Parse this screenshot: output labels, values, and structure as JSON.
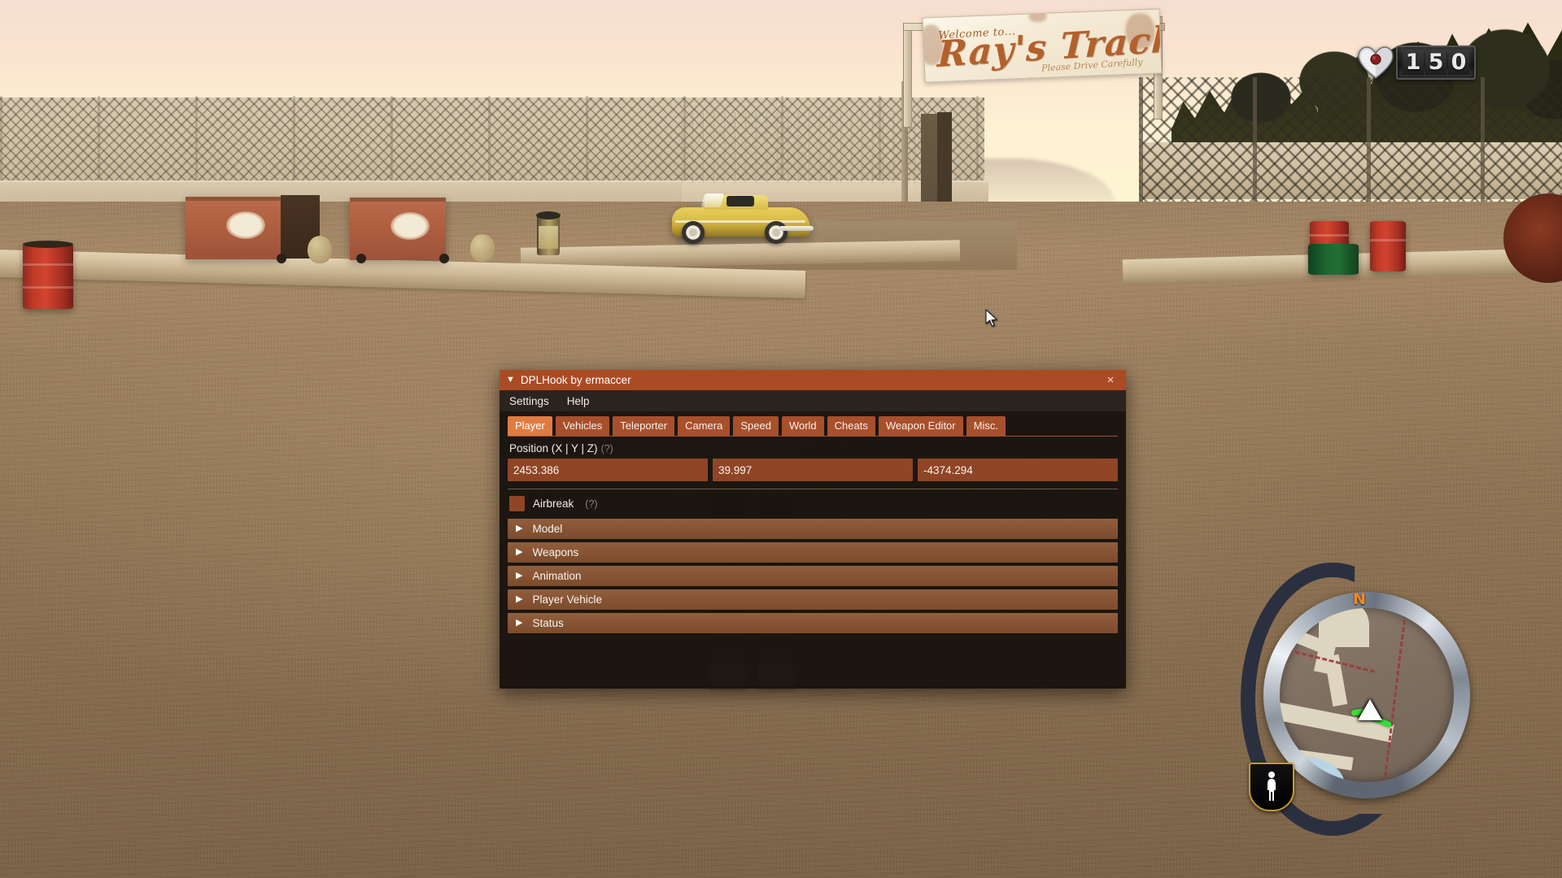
{
  "hud": {
    "health": {
      "icon": "heart-icon",
      "value": "150",
      "digits": [
        "1",
        "5",
        "0"
      ]
    },
    "minimap": {
      "compass_label": "N",
      "player_marker_icon": "player-arrow-icon",
      "ped_badge_icon": "pedestrian-icon"
    }
  },
  "scene": {
    "sign": {
      "welcome_text": "Welcome to...",
      "main_text": "Ray's Track",
      "sub_text": "Please Drive Carefully"
    }
  },
  "window": {
    "title": "DPLHook by ermaccer",
    "collapse_icon": "collapse-triangle-icon",
    "close_icon": "close-icon",
    "close_label": "×",
    "menu": [
      {
        "label": "Settings"
      },
      {
        "label": "Help"
      }
    ],
    "tabs": [
      {
        "label": "Player",
        "active": true
      },
      {
        "label": "Vehicles",
        "active": false
      },
      {
        "label": "Teleporter",
        "active": false
      },
      {
        "label": "Camera",
        "active": false
      },
      {
        "label": "Speed",
        "active": false
      },
      {
        "label": "World",
        "active": false
      },
      {
        "label": "Cheats",
        "active": false
      },
      {
        "label": "Weapon Editor",
        "active": false
      },
      {
        "label": "Misc.",
        "active": false
      }
    ],
    "player_tab": {
      "position": {
        "label": "Position (X | Y | Z)",
        "hint": "(?)",
        "x": "2453.386",
        "y": "39.997",
        "z": "-4374.294"
      },
      "airbreak": {
        "label": "Airbreak",
        "hint": "(?)",
        "checked": false
      },
      "sections": [
        {
          "label": "Model",
          "expanded": false
        },
        {
          "label": "Weapons",
          "expanded": false
        },
        {
          "label": "Animation",
          "expanded": false
        },
        {
          "label": "Player Vehicle",
          "expanded": false
        },
        {
          "label": "Status",
          "expanded": false
        }
      ]
    }
  },
  "colors": {
    "titlebar": "#ab4b25",
    "tab_active": "#e07b42",
    "tab_inactive": "#a8502c",
    "input_bg": "#8f4526",
    "section_bg": "#8a5431",
    "panel_bg": "#1a1310",
    "compass_accent": "#f08a1e"
  }
}
